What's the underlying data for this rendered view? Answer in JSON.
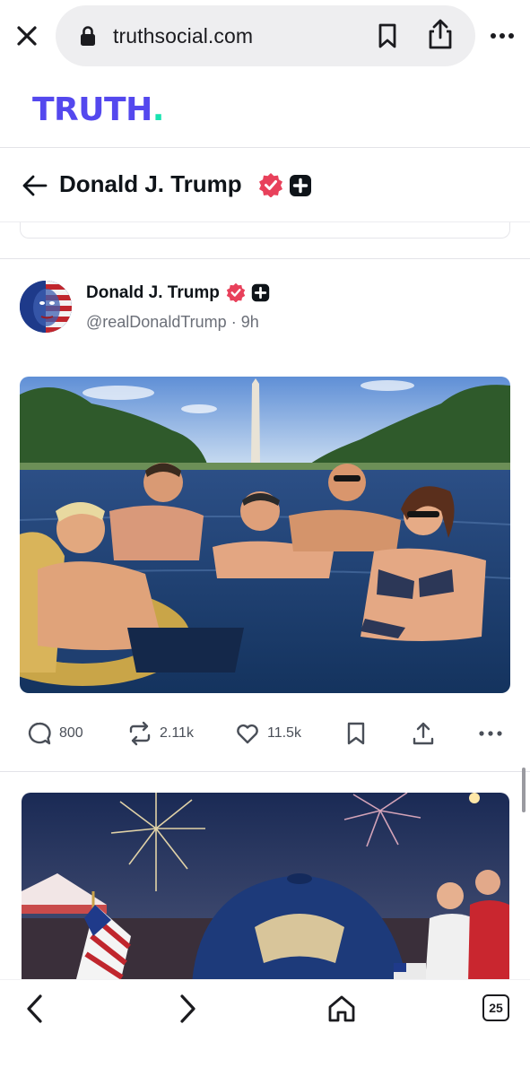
{
  "browser": {
    "url": "truthsocial.com",
    "tab_count": "25"
  },
  "brand": {
    "logo_text": "TRUTH",
    "logo_dot": ".",
    "accent": "#5448ee",
    "dot_color": "#17e3b0"
  },
  "profile": {
    "name": "Donald J. Trump"
  },
  "post": {
    "author_name": "Donald J. Trump",
    "handle": "@realDonaldTrump",
    "separator": "·",
    "time": "9h",
    "replies": "800",
    "retruths": "2.11k",
    "likes": "11.5k"
  },
  "colors": {
    "verified": "#e8415b",
    "plus_badge": "#0f1419"
  },
  "icons": {
    "close": "close-icon",
    "lock": "lock-icon",
    "bookmark": "bookmark-icon",
    "share": "share-icon",
    "more": "more-icon",
    "back": "back-arrow-icon",
    "verified": "verified-badge-icon",
    "plus": "plus-badge-icon",
    "reply": "reply-icon",
    "retruth": "retruth-icon",
    "like": "heart-icon",
    "upload": "upload-icon",
    "home": "home-icon",
    "nav_back": "chevron-left-icon",
    "nav_forward": "chevron-right-icon"
  }
}
